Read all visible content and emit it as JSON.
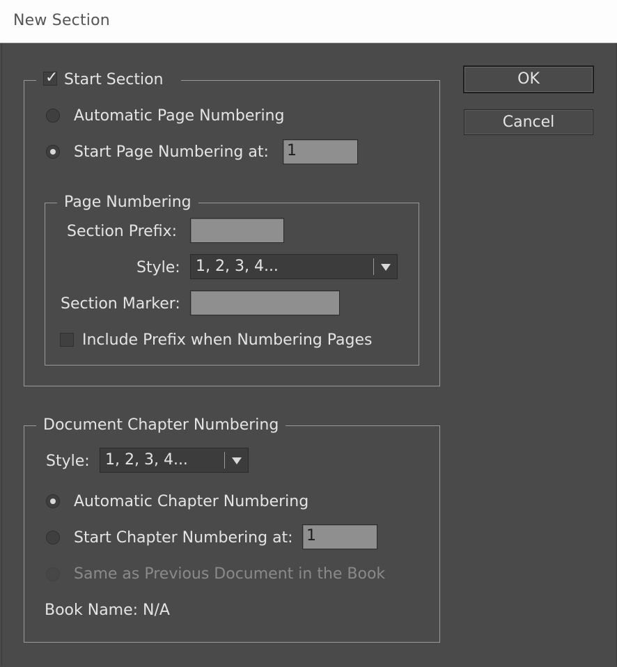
{
  "window": {
    "title": "New Section"
  },
  "buttons": {
    "ok": "OK",
    "cancel": "Cancel"
  },
  "start_section": {
    "label": "Start Section",
    "checked": true,
    "automatic_page_numbering": "Automatic Page Numbering",
    "start_page_numbering_at": "Start Page Numbering at:",
    "start_page_value": "1",
    "page_numbering_mode": "start_at"
  },
  "page_numbering": {
    "legend": "Page Numbering",
    "section_prefix_label": "Section Prefix:",
    "section_prefix_value": "",
    "style_label": "Style:",
    "style_value": "1, 2, 3, 4...",
    "section_marker_label": "Section Marker:",
    "section_marker_value": "",
    "include_prefix_label": "Include Prefix when Numbering Pages",
    "include_prefix_checked": false
  },
  "chapter_numbering": {
    "legend": "Document Chapter Numbering",
    "style_label": "Style:",
    "style_value": "1, 2, 3, 4...",
    "automatic_label": "Automatic Chapter Numbering",
    "start_at_label": "Start Chapter Numbering at:",
    "start_at_value": "1",
    "same_as_previous_label": "Same as Previous Document in the Book",
    "selected": "automatic",
    "book_name_label": "Book Name: N/A"
  },
  "icons": {
    "checkbox_checked": "checkmark-icon",
    "dropdown": "chevron-down-icon"
  }
}
